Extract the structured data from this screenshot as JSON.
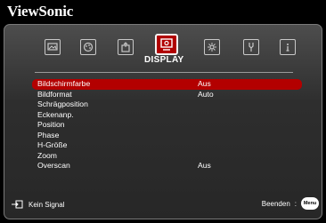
{
  "brand": "ViewSonic",
  "tabs": [
    {
      "icon": "picture-icon"
    },
    {
      "icon": "audio-palette-icon"
    },
    {
      "icon": "setup-icon"
    },
    {
      "icon": "display-icon",
      "active": true
    },
    {
      "icon": "gear-icon"
    },
    {
      "icon": "tools-icon"
    },
    {
      "icon": "information-icon"
    }
  ],
  "active_tab_label": "DISPLAY",
  "menu": [
    {
      "label": "Bildschirmfarbe",
      "value": "Aus",
      "selected": true
    },
    {
      "label": "Bildformat",
      "value": "Auto"
    },
    {
      "label": "Schrägposition",
      "value": ""
    },
    {
      "label": "Eckenanp.",
      "value": ""
    },
    {
      "label": "Position",
      "value": ""
    },
    {
      "label": "Phase",
      "value": ""
    },
    {
      "label": "H-Größe",
      "value": ""
    },
    {
      "label": "Zoom",
      "value": ""
    },
    {
      "label": "Overscan",
      "value": "Aus"
    }
  ],
  "footer": {
    "source_status": "Kein Signal",
    "exit_label": "Beenden",
    "menu_button": "Menu"
  },
  "colors": {
    "accent": "#b30000"
  }
}
